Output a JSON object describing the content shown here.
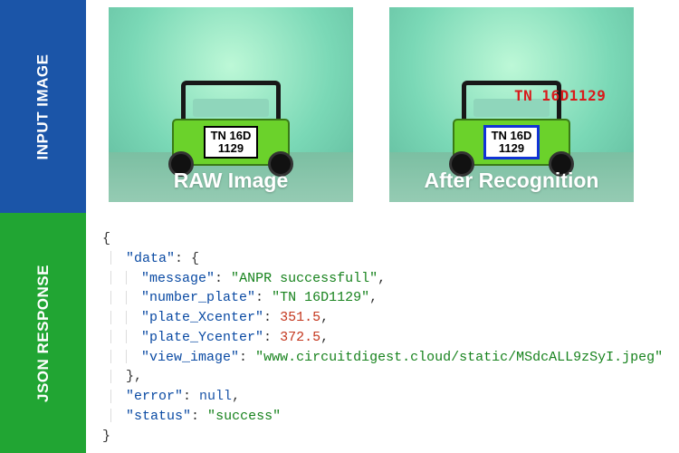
{
  "labels": {
    "input_sidebar": "INPUT IMAGE",
    "json_sidebar": "JSON RESPONSE",
    "raw_caption": "RAW Image",
    "after_caption": "After Recognition"
  },
  "plate": {
    "line1": "TN 16D",
    "line2": "1129"
  },
  "ocr_overlay_text": "TN 16D1129",
  "json_response": {
    "data": {
      "message": "ANPR successfull",
      "number_plate": "TN 16D1129",
      "plate_Xcenter": 351.5,
      "plate_Ycenter": 372.5,
      "view_image": "www.circuitdigest.cloud/static/MSdcALL9zSyI.jpeg"
    },
    "error": null,
    "status": "success"
  },
  "brace_open": "{",
  "brace_close": "}"
}
